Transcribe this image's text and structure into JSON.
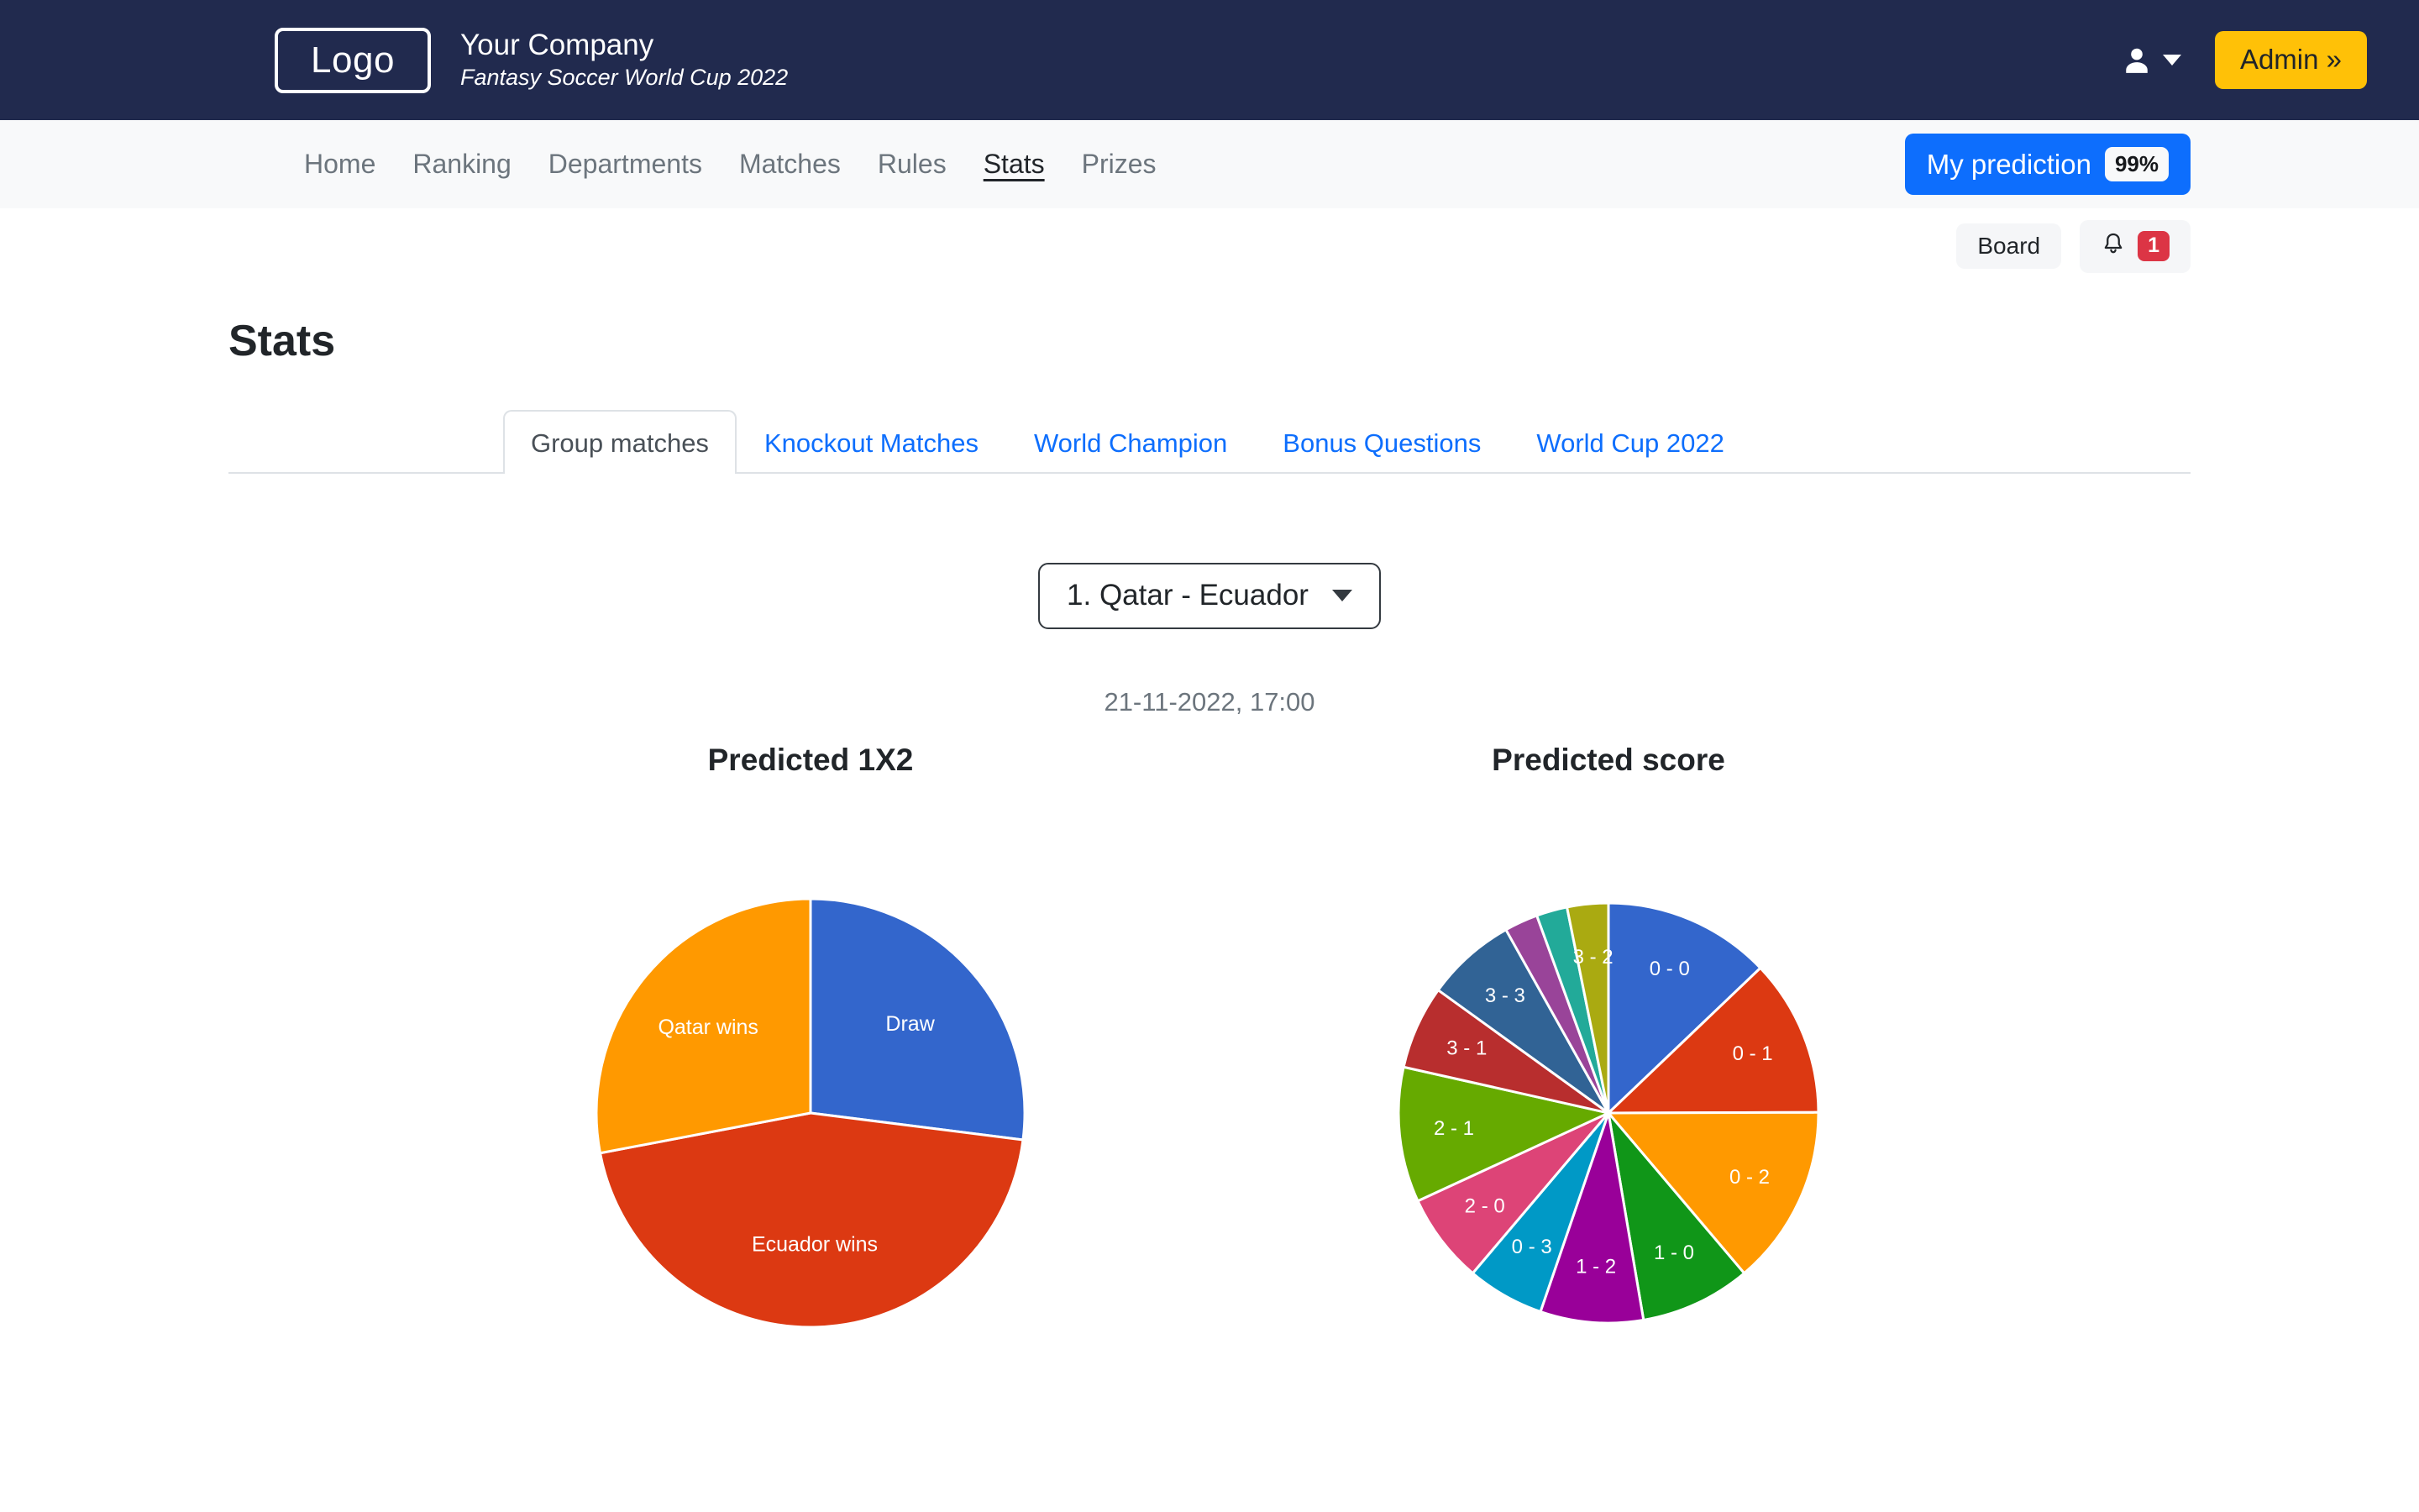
{
  "header": {
    "logo_text": "Logo",
    "company": "Your Company",
    "tagline": "Fantasy Soccer World Cup 2022",
    "user_icon": "user-icon",
    "admin_label": "Admin »"
  },
  "nav": {
    "items": [
      {
        "label": "Home",
        "active": false
      },
      {
        "label": "Ranking",
        "active": false
      },
      {
        "label": "Departments",
        "active": false
      },
      {
        "label": "Matches",
        "active": false
      },
      {
        "label": "Rules",
        "active": false
      },
      {
        "label": "Stats",
        "active": true
      },
      {
        "label": "Prizes",
        "active": false
      }
    ],
    "prediction_label": "My prediction",
    "prediction_badge": "99%"
  },
  "subbar": {
    "board_label": "Board",
    "bell_icon": "bell-icon",
    "notification_count": "1"
  },
  "main": {
    "page_title": "Stats",
    "tabs": [
      {
        "label": "Group matches",
        "active": true
      },
      {
        "label": "Knockout Matches",
        "active": false
      },
      {
        "label": "World Champion",
        "active": false
      },
      {
        "label": "Bonus Questions",
        "active": false
      },
      {
        "label": "World Cup 2022",
        "active": false
      }
    ],
    "match_select_value": "1. Qatar - Ecuador",
    "match_date": "21-11-2022, 17:00"
  },
  "colors": {
    "header_bg": "#212a4e",
    "navbar_bg": "#f8f9fa",
    "accent_blue": "#0d6efd",
    "accent_yellow": "#ffc107",
    "badge_red": "#dc3545"
  },
  "chart_data": [
    {
      "type": "pie",
      "title": "Predicted 1X2",
      "categories": [
        "Draw",
        "Ecuador wins",
        "Qatar wins"
      ],
      "values": [
        27,
        45,
        28
      ],
      "colors": [
        "#3366cc",
        "#dc3912",
        "#ff9900"
      ],
      "start_angle": 0,
      "legend": "none",
      "labels_inside": true
    },
    {
      "type": "pie",
      "title": "Predicted score",
      "categories": [
        "0 - 0",
        "0 - 1",
        "0 - 2",
        "1 - 0",
        "1 - 2",
        "0 - 3",
        "2 - 0",
        "2 - 1",
        "3 - 1",
        "3 - 3",
        "",
        "",
        "3 - 2"
      ],
      "values": [
        13.0,
        12.2,
        14.0,
        8.6,
        8.0,
        6.0,
        7.0,
        10.5,
        6.5,
        7.0,
        2.6,
        2.4,
        3.2
      ],
      "colors": [
        "#3366cc",
        "#dc3912",
        "#ff9900",
        "#109618",
        "#990099",
        "#0099c6",
        "#dd4477",
        "#66aa00",
        "#b82e2e",
        "#316395",
        "#994499",
        "#22aa99",
        "#aaaa11"
      ],
      "start_angle": 0,
      "legend": "none",
      "labels_inside": true
    }
  ]
}
